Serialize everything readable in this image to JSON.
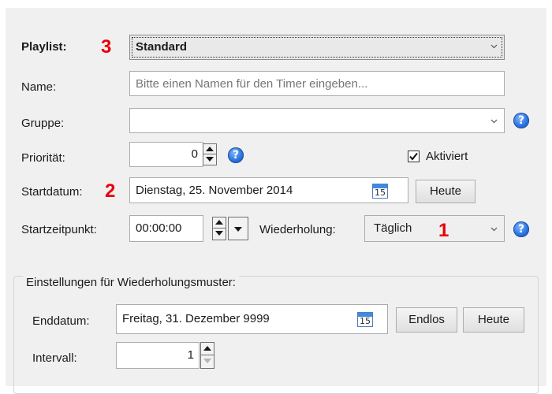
{
  "timer_form": {
    "playlist": {
      "label": "Playlist:",
      "value": "Standard",
      "marker": "3"
    },
    "name": {
      "label": "Name:",
      "value": "",
      "placeholder": "Bitte einen Namen für den Timer eingeben..."
    },
    "group": {
      "label": "Gruppe:",
      "value": ""
    },
    "priority": {
      "label": "Priorität:",
      "value": "0"
    },
    "activated": {
      "label": "Aktiviert",
      "checked": true
    },
    "start_date": {
      "label": "Startdatum:",
      "marker": "2",
      "value": "Dienstag, 25. November 2014",
      "calendar_day": "15",
      "today_label": "Heute"
    },
    "start_time": {
      "label": "Startzeitpunkt:",
      "value": "00:00:00"
    },
    "repeat": {
      "label": "Wiederholung:",
      "value": "Täglich",
      "marker": "1"
    },
    "help_glyph": "?"
  },
  "pattern_settings": {
    "title": "Einstellungen für Wiederholungsmuster:",
    "end_date": {
      "label": "Enddatum:",
      "value": "Freitag, 31. Dezember 9999",
      "calendar_day": "15",
      "endless_label": "Endlos",
      "today_label": "Heute"
    },
    "interval": {
      "label": "Intervall:",
      "value": "1"
    }
  },
  "colors": {
    "marker": "#e8000a",
    "help_icon": "#2a73e0",
    "calendar_accent": "#3f8be0"
  }
}
